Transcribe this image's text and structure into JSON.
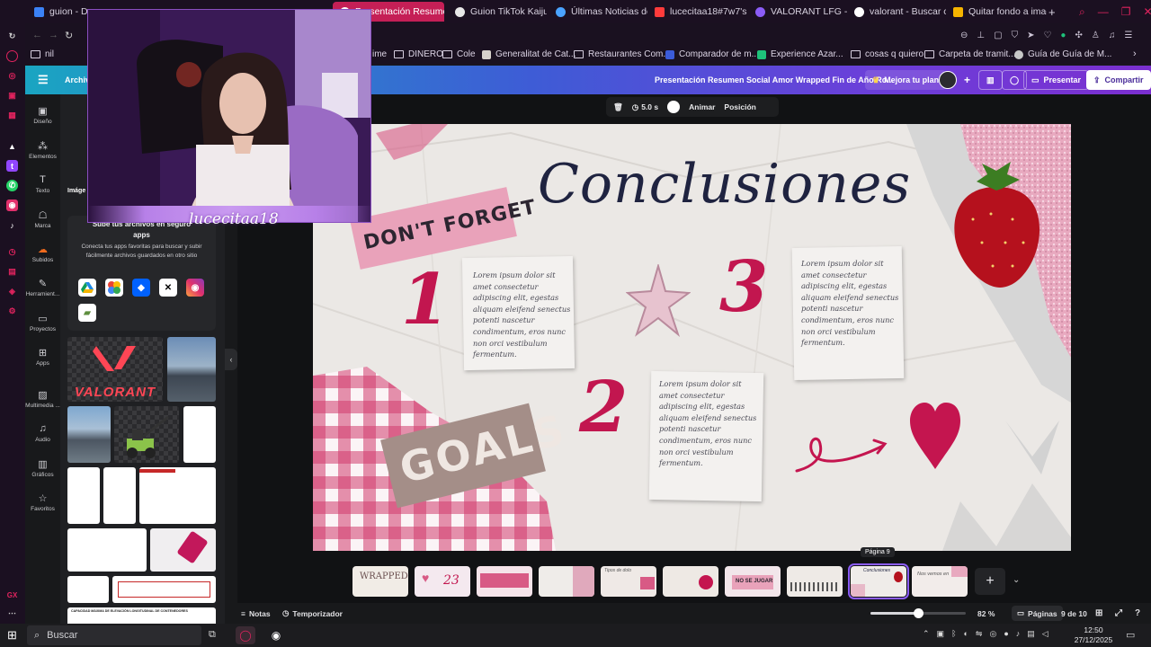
{
  "browser": {
    "tabs": [
      {
        "title": "guion - Documen",
        "color": "#3b82f6"
      },
      {
        "title": "",
        "color": "#2b2b2f"
      },
      {
        "title": "",
        "color": "#2b2b2f"
      },
      {
        "title": "Presentación Resumen S",
        "color": "#ffffff"
      },
      {
        "title": "Guion TikTok Kaiju N",
        "color": "#e8e8e8"
      },
      {
        "title": "Últimas Noticias de A",
        "color": "#4aa3ff"
      },
      {
        "title": "lucecitaa18#7w7's C",
        "color": "#ff3b3b"
      },
      {
        "title": "VALORANT LFG - Ga",
        "color": "#8b5cf6"
      },
      {
        "title": "valorant - Buscar con",
        "color": "#ffffff"
      },
      {
        "title": "Quitar fondo a image",
        "color": "#f5b400"
      }
    ],
    "new_tab": "+",
    "bookmarks": [
      {
        "label": "nil",
        "type": "folder"
      },
      {
        "label": "not",
        "type": "folder"
      },
      {
        "label": "ime",
        "type": "folder"
      },
      {
        "label": "DINERO",
        "type": "folder"
      },
      {
        "label": "Cole",
        "type": "folder"
      },
      {
        "label": "Generalitat de Cat...",
        "type": "site",
        "color": "#d7d2cc"
      },
      {
        "label": "Restaurantes Com...",
        "type": "folder"
      },
      {
        "label": "Comparador de m...",
        "type": "site",
        "color": "#3b5bd9"
      },
      {
        "label": "Experience Azar...",
        "type": "site",
        "color": "#1ec27a"
      },
      {
        "label": "cosas q quiero",
        "type": "folder"
      },
      {
        "label": "Carpeta de tramit...",
        "type": "folder"
      },
      {
        "label": "Guía de Guía de M...",
        "type": "site",
        "color": "#c7c7c7"
      }
    ]
  },
  "canva": {
    "menu_label": "Archivo",
    "doc_title": "Presentación Resumen Social Amor Wrapped Fin de Año Ro...",
    "upgrade_label": "Mejora tu plan",
    "add_label": "+",
    "present_label": "Presentar",
    "share_label": "Compartir",
    "nav": [
      {
        "label": "Diseño",
        "icon": "design-icon"
      },
      {
        "label": "Elementos",
        "icon": "elements-icon"
      },
      {
        "label": "Texto",
        "icon": "text-icon"
      },
      {
        "label": "Marca",
        "icon": "brand-icon"
      },
      {
        "label": "Subidos",
        "icon": "uploads-icon"
      },
      {
        "label": "Herramient...",
        "icon": "tools-icon"
      },
      {
        "label": "Proyectos",
        "icon": "projects-icon"
      },
      {
        "label": "Apps",
        "icon": "apps-icon"
      },
      {
        "label": "Multimedia ...",
        "icon": "multimedia-icon"
      },
      {
        "label": "Audio",
        "icon": "audio-icon"
      },
      {
        "label": "Gráficos",
        "icon": "charts-icon"
      },
      {
        "label": "Favoritos",
        "icon": "favorites-icon"
      }
    ],
    "panel": {
      "tab_images": "Imáge",
      "apps_title": "Sube tus archivos en seguro\napps",
      "apps_desc": "Conecta tus apps favoritas para buscar y subir fácilmente archivos guardados en otro sitio",
      "thumb_valorant": "VALORANT",
      "thumb_table_title": "CAPACIDAD MÁXIMA DE ELEVACIÓN LONGITUDINAL DE CONTENEDORES"
    },
    "toolbar": {
      "duration": "5.0 s",
      "animate": "Animar",
      "position": "Posición"
    },
    "slide": {
      "title": "Conclusiones",
      "tag_top": "DON'T FORGET",
      "tag_bottom": "GOALS",
      "num1": "1",
      "num2": "2",
      "num3": "3",
      "text1": "Lorem ipsum dolor sit\namet consectetur\nadipiscing elit, egestas\naliquam eleifend senectus\npotenti nascetur\ncondimentum, eros nunc\nnon orci vestibulum\nfermentum.",
      "text2": "Lorem ipsum dolor sit\namet consectetur\nadipiscing elit, egestas\naliquam eleifend senectus\npotenti nascetur\ncondimentum, eros nunc\nnon orci vestibulum\nfermentum.",
      "text3": "Lorem ipsum dolor sit\namet consectetur\nadipiscing elit, egestas\naliquam eleifend senectus\npotenti nascetur\ncondimentum, eros nunc\nnon orci vestibulum\nfermentum."
    },
    "pages": {
      "tooltip": "Página 9",
      "thumbs": [
        {
          "label": "WRAPPED",
          "bg": "#f1ece6"
        },
        {
          "label": "23",
          "bg": "#f4e9ef"
        },
        {
          "label": "",
          "bg": "#f5e4ea"
        },
        {
          "label": "",
          "bg": "#efece9"
        },
        {
          "label": "Tipos de dolo",
          "bg": "#efe9e6"
        },
        {
          "label": "",
          "bg": "#eee9e4"
        },
        {
          "label": "NO SE JUGAR",
          "bg": "#f2e6ea"
        },
        {
          "label": "",
          "bg": "#eeeae6"
        },
        {
          "label": "Conclusiones",
          "bg": "#efece9"
        },
        {
          "label": "Nos vemos en",
          "bg": "#f2ecea"
        }
      ],
      "selected_index": 8,
      "add_label": "+"
    },
    "footer": {
      "notes": "Notas",
      "timer": "Temporizador",
      "zoom": "82 %",
      "zoom_fraction": 0.5,
      "pages_label": "Páginas",
      "page_count": "9 de 10"
    }
  },
  "webcam": {
    "name": "lucecitaa18"
  },
  "taskbar": {
    "search_placeholder": "Buscar",
    "time": "12:50",
    "date": "27/12/2025"
  },
  "colors": {
    "accent": "#8b5cf6",
    "brand_pink": "#c2164f",
    "canva_teal": "#1aa5c2"
  }
}
